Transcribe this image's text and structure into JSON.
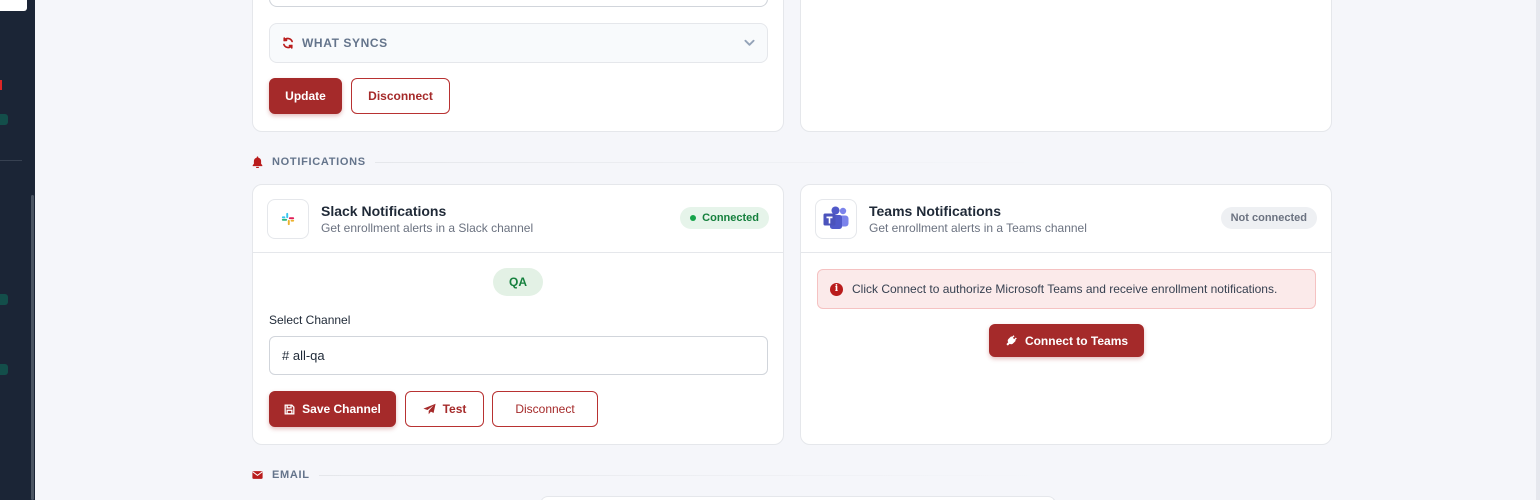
{
  "sync_card": {
    "what_syncs_label": "WHAT SYNCS",
    "update_label": "Update",
    "disconnect_label": "Disconnect"
  },
  "sections": {
    "notifications_label": "NOTIFICATIONS",
    "email_label": "EMAIL"
  },
  "slack": {
    "title": "Slack Notifications",
    "description": "Get enrollment alerts in a Slack channel",
    "status": "Connected",
    "workspace_chip": "QA",
    "channel_label": "Select Channel",
    "channel_value": "# all-qa",
    "save_label": "Save Channel",
    "test_label": "Test",
    "disconnect_label": "Disconnect"
  },
  "teams": {
    "title": "Teams Notifications",
    "description": "Get enrollment alerts in a Teams channel",
    "status": "Not connected",
    "alert_text": "Click Connect to authorize Microsoft Teams and receive enrollment notifications.",
    "connect_label": "Connect to Teams"
  },
  "colors": {
    "brand": "#a52a2a",
    "connected": "#15803d",
    "teams_purple": "#5059c9"
  },
  "icons": {
    "sync": "refresh-icon",
    "chevron": "chevron-down-icon",
    "bell": "bell-icon",
    "mail": "envelope-icon",
    "save": "floppy-disk-icon",
    "test": "paper-plane-icon",
    "plug": "plug-icon",
    "info": "info-circle-icon"
  }
}
